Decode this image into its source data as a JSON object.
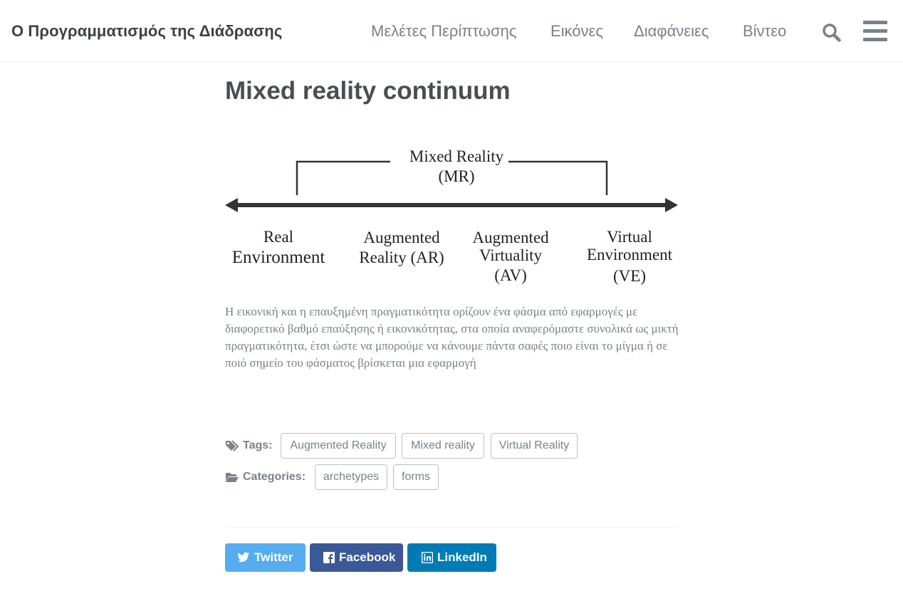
{
  "header": {
    "site_title": "Ο Προγραμματισμός της Διάδρασης",
    "nav": [
      {
        "label": "Μελέτες Περίπτωσης"
      },
      {
        "label": "Εικόνες"
      },
      {
        "label": "Διαφάνειες"
      },
      {
        "label": "Βίντεο"
      }
    ],
    "search_icon": "search-icon",
    "menu_icon": "hamburger-icon"
  },
  "page": {
    "title": "Mixed reality continuum",
    "description": "Η εικονική και η επαυξημένη πραγματικότητα ορίζουν ένα φάσμα από εφαρμογές με διαφορετικό βαθμό επαύξησης ή εικονικότητας, στα οποία αναφερόμαστε συνολικά ως μικτή πραγματικότητα, έτσι ώστε να μπορούμε να κάνουμε πάντα σαφές ποιο είναι το μίγμα ή σε ποιό σημείο του φάσματος βρίσκεται μια εφαρμογή"
  },
  "figure": {
    "bracket_label_line1": "Mixed Reality",
    "bracket_label_line2": "(MR)",
    "stages": [
      {
        "lines": [
          "Real",
          "Environment"
        ]
      },
      {
        "lines": [
          "Augmented",
          "Reality (AR)"
        ]
      },
      {
        "lines": [
          "Augmented",
          "Virtuality",
          "(AV)"
        ]
      },
      {
        "lines": [
          "Virtual",
          "Environment",
          "(VE)"
        ]
      }
    ]
  },
  "taxonomy": {
    "tags_label": "Tags:",
    "tags": [
      "Augmented Reality",
      "Mixed reality",
      "Virtual Reality"
    ],
    "categories_label": "Categories:",
    "categories": [
      "archetypes",
      "forms"
    ]
  },
  "share": {
    "twitter_label": "Twitter",
    "facebook_label": "Facebook",
    "linkedin_label": "LinkedIn",
    "colors": {
      "twitter": "#55acee",
      "facebook": "#3b5998",
      "linkedin": "#007bb6"
    }
  }
}
